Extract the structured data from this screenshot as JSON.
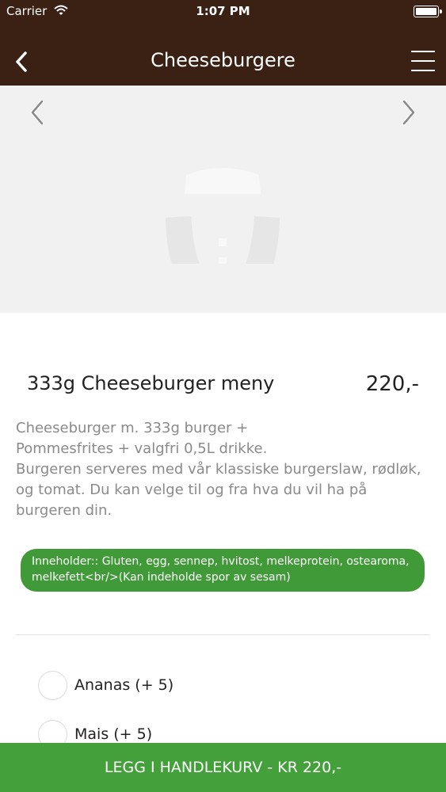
{
  "status_bar": {
    "carrier": "Carrier",
    "time": "1:07 PM"
  },
  "nav": {
    "title": "Cheeseburgere",
    "back_icon": "chevron-left-icon",
    "menu_icon": "hamburger-menu-icon"
  },
  "carousel": {
    "prev_icon": "chevron-left-icon",
    "next_icon": "chevron-right-icon",
    "image": "placeholder-logo"
  },
  "product": {
    "name": "333g Cheeseburger meny",
    "price": "220,-",
    "description_lines": [
      "Cheeseburger m. 333g burger +",
      "Pommesfrites + valgfri 0,5L drikke.",
      "Burgeren serveres med vår klassiske burgerslaw, rødløk,",
      "og tomat. Du kan velge til og fra hva du vil ha på",
      "burgeren din."
    ],
    "allergens": "Inneholder:: Gluten, egg, sennep, hvitost, melkeprotein, ostearoma, melkefett<br/>(Kan indeholde spor av sesam)"
  },
  "options": [
    {
      "label": "Ananas (+ 5)",
      "selected": false
    },
    {
      "label": "Mais (+ 5)",
      "selected": false
    }
  ],
  "cart_button": {
    "label": "LEGG I HANDLEKURV - KR 220,-"
  },
  "colors": {
    "header": "#3b2014",
    "accent_green": "#43a03a",
    "badge_green": "#3f9a37"
  }
}
